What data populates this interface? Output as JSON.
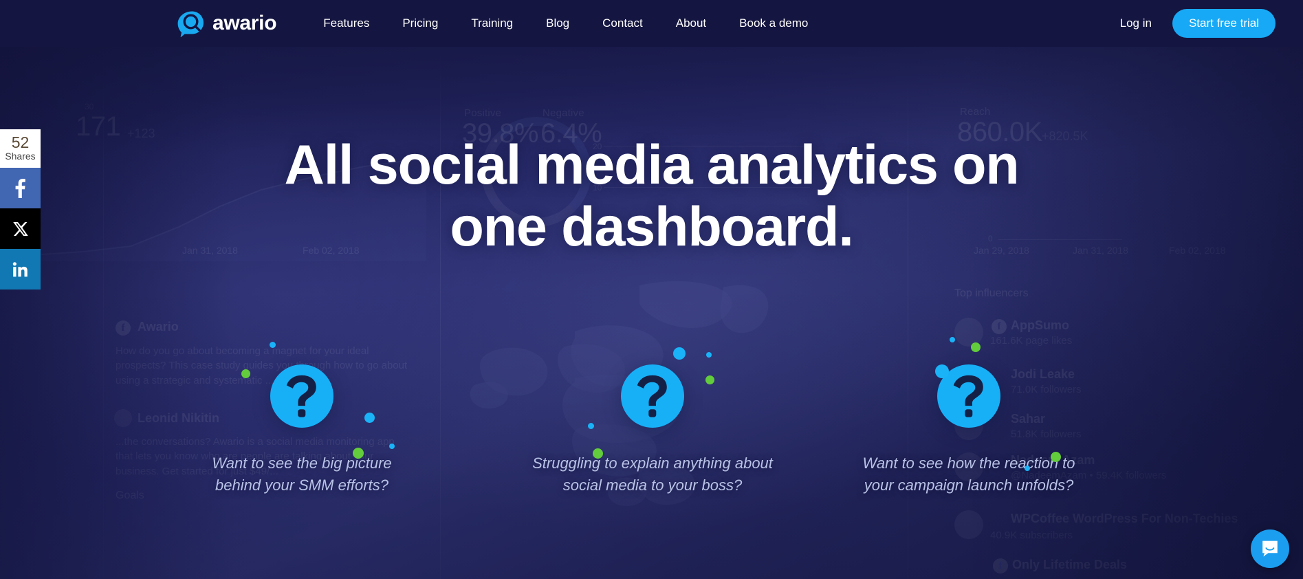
{
  "brand": {
    "name": "awario",
    "logo_icon": "awario-speech-search-logo",
    "accent": "#17a9f5",
    "navbar_bg": "#141540"
  },
  "nav": {
    "links": [
      {
        "label": "Features"
      },
      {
        "label": "Pricing"
      },
      {
        "label": "Training"
      },
      {
        "label": "Blog"
      },
      {
        "label": "Contact"
      },
      {
        "label": "About"
      },
      {
        "label": "Book a demo"
      }
    ],
    "login_label": "Log in",
    "cta_label": "Start free trial"
  },
  "share_rail": {
    "count": "52",
    "count_label": "Shares",
    "buttons": [
      {
        "network": "facebook",
        "glyph": "f",
        "color": "#4267b2"
      },
      {
        "network": "twitter-x",
        "glyph": "X",
        "color": "#000000"
      },
      {
        "network": "linkedin",
        "glyph": "in",
        "color": "#1178b3"
      }
    ]
  },
  "hero": {
    "title_line1": "All social media analytics on",
    "title_line2": "one dashboard.",
    "cards": [
      {
        "icon": "question-mark-icon",
        "line1": "Want to see the big picture",
        "line2": "behind your SMM efforts?"
      },
      {
        "icon": "question-mark-icon",
        "line1": "Struggling to explain anything about",
        "line2": "social media to your boss?"
      },
      {
        "icon": "question-mark-icon",
        "line1": "Want to see how the reaction to",
        "line2": "your campaign launch unfolds?"
      }
    ],
    "dot_colors": {
      "cyan": "#1ab3f8",
      "green": "#63cc3c"
    }
  },
  "background_dashboard": {
    "mentions_panel": {
      "axis_top": "30",
      "value": "171",
      "delta": "+123",
      "dates": [
        "Jan 31, 2018",
        "Feb 02, 2018"
      ]
    },
    "sentiment_panel": {
      "positive_label": "Positive",
      "positive_value": "39.8%",
      "negative_label": "Negative",
      "negative_value": "6.4%",
      "axis_labels": [
        "20",
        "10"
      ]
    },
    "reach_panel": {
      "label": "Reach",
      "value": "860.0K",
      "delta": "+820.5K",
      "axis_zero": "0",
      "dates": [
        "Jan 29, 2018",
        "Jan 31, 2018",
        "Feb 02, 2018"
      ]
    },
    "feed_panel": {
      "items": [
        {
          "author": "Awario",
          "network": "facebook",
          "body": "How do you go about becoming a magnet for your ideal prospects? This case study guides you through how to go about using a strategic and systematic ...",
          "author2": "Leonid Nikitin",
          "body2": "...the conversations? Awario is a social media monitoring app that lets you know who are people are talking about your business. Get started for just $49/..."
        }
      ],
      "footer_label": "Goals"
    },
    "influencers_panel": {
      "title": "Top influencers",
      "rows": [
        {
          "name": "AppSumo",
          "network": "facebook",
          "metric": "161.6K page likes"
        },
        {
          "name": "Jodi Leake",
          "network": "twitter",
          "metric": "71.0K followers"
        },
        {
          "name": "Sahar",
          "network": "twitter",
          "metric": "51.8K followers"
        },
        {
          "name": "Nadeem Azam",
          "network": "twitter",
          "metric": "@NadeemAzam  •  59.4K followers"
        },
        {
          "name": "WPCoffee WordPress For Non-Techies",
          "network": "youtube",
          "metric": "40.9K subscribers"
        },
        {
          "name": "Only Lifetime Deals",
          "network": "facebook",
          "metric": ""
        }
      ]
    }
  },
  "intercom": {
    "icon": "chat-bubble-icon",
    "color": "#1b9ef0"
  }
}
